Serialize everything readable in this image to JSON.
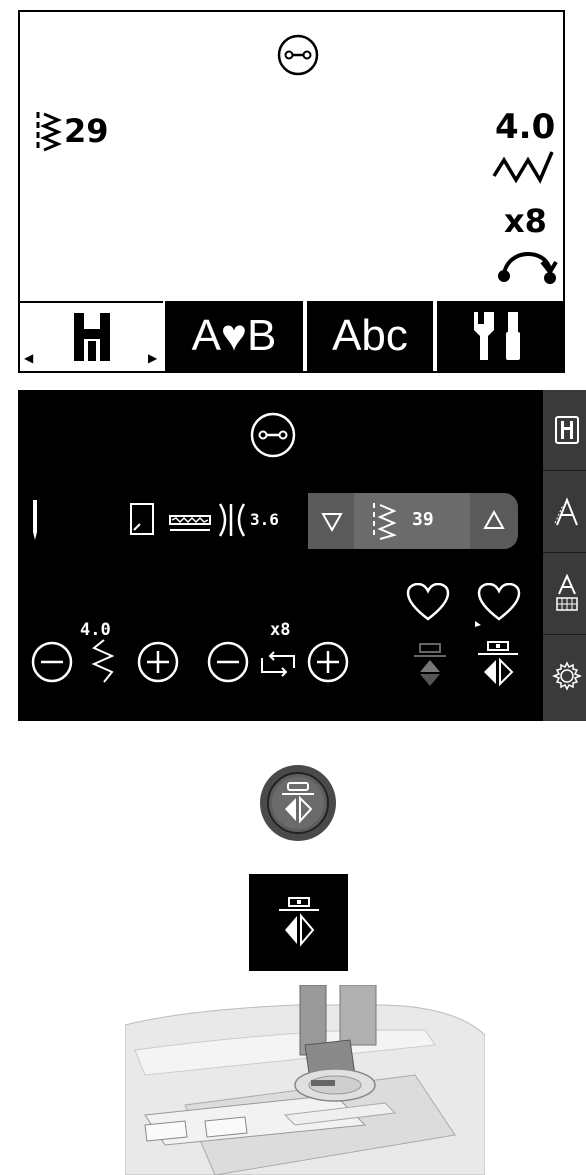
{
  "panel1": {
    "stitch_number": "29",
    "stitch_width": "4.0",
    "repeat_count": "x8",
    "tabs": [
      {
        "label": "",
        "icon": "presser-foot-icon",
        "selected": true
      },
      {
        "label": "A♥B",
        "icon": "decorative-stitch-icon",
        "selected": false
      },
      {
        "label": "Abc",
        "icon": "font-icon",
        "selected": false
      },
      {
        "label": "",
        "icon": "settings-tools-icon",
        "selected": false
      }
    ]
  },
  "panel2": {
    "stitch_length_display": "3.6",
    "stitch_number": "39",
    "width_value": "4.0",
    "repeat_value": "x8",
    "sidebar": [
      "presser-foot-icon",
      "font-a-icon",
      "font-keyboard-icon",
      "settings-gear-icon"
    ]
  },
  "colors": {
    "lcd_bg": "#ffffff",
    "screen_bg": "#000000",
    "sidebar_bg": "#3a3a3a",
    "stitch_bar": "#5a5a5a"
  }
}
